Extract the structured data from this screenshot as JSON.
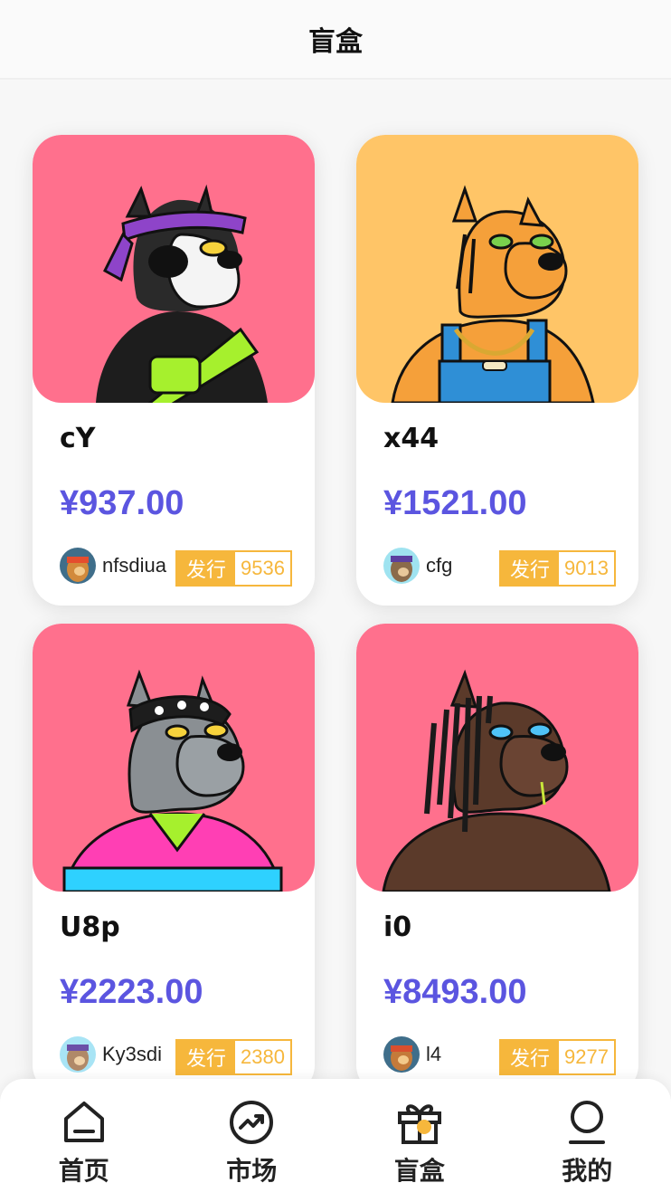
{
  "header": {
    "title": "盲盒"
  },
  "cards": [
    {
      "name": "cY",
      "price": "¥937.00",
      "creator": "nfsdiua",
      "issue_label": "发行",
      "issue_count": "9536",
      "bg": "#ff708d",
      "icon": "dog-bandana-art"
    },
    {
      "name": "x44",
      "price": "¥1521.00",
      "creator": "cfg",
      "issue_label": "发行",
      "issue_count": "9013",
      "bg": "#ffc567",
      "icon": "tiger-dog-art"
    },
    {
      "name": "U8p",
      "price": "¥2223.00",
      "creator": "Ky3sdi",
      "issue_label": "发行",
      "issue_count": "2380",
      "bg": "#ff708d",
      "icon": "gray-dog-skull-bandana-art"
    },
    {
      "name": "i0",
      "price": "¥8493.00",
      "creator": "l4",
      "issue_label": "发行",
      "issue_count": "9277",
      "bg": "#ff708d",
      "icon": "brown-dog-dreadlocks-art"
    }
  ],
  "tabs": [
    {
      "label": "首页",
      "icon": "home-icon"
    },
    {
      "label": "市场",
      "icon": "trend-icon"
    },
    {
      "label": "盲盒",
      "icon": "gift-icon"
    },
    {
      "label": "我的",
      "icon": "user-icon"
    }
  ],
  "colors": {
    "price": "#5b55e0",
    "issue": "#f6b73c",
    "card_pink": "#ff708d",
    "card_orange": "#ffc567"
  }
}
